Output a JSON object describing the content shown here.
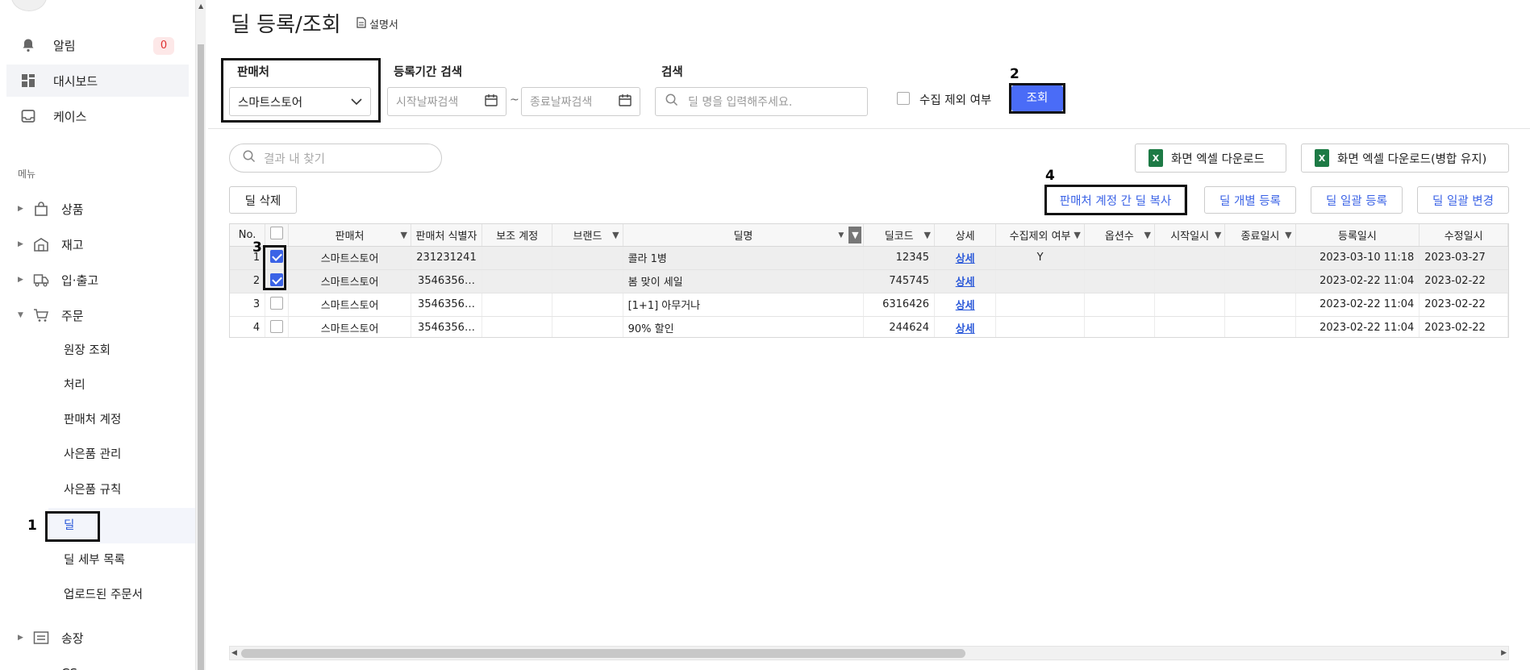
{
  "sidebar": {
    "alerts_label": "알림",
    "alerts_count": "0",
    "dashboard_label": "대시보드",
    "cases_label": "케이스",
    "menu_heading": "메뉴",
    "menu": [
      {
        "label": "상품",
        "icon": "bag-icon"
      },
      {
        "label": "재고",
        "icon": "warehouse-icon"
      },
      {
        "label": "입·출고",
        "icon": "truck-icon"
      },
      {
        "label": "주문",
        "icon": "cart-icon"
      }
    ],
    "order_sub": [
      "원장 조회",
      "처리",
      "판매처 계정",
      "사은품 관리",
      "사은품 규칙",
      "딜",
      "딜 세부 목록",
      "업로드된 주문서"
    ],
    "invoice_label": "송장",
    "cs_label": "CS"
  },
  "annotations": {
    "n1": "1",
    "n2": "2",
    "n3": "3",
    "n4": "4"
  },
  "header": {
    "title": "딜 등록/조회",
    "manual": "설명서"
  },
  "filters": {
    "seller_label": "판매처",
    "seller_value": "스마트스토어",
    "period_label": "등록기간 검색",
    "start_placeholder": "시작날짜검색",
    "end_placeholder": "종료날짜검색",
    "tilde": "~",
    "search_label": "검색",
    "search_placeholder": "딜 명을 입력해주세요.",
    "exclude_label": "수집 제외 여부",
    "query_button": "조회"
  },
  "toolbar": {
    "find_placeholder": "결과 내 찾기",
    "excel_download": "화면 엑셀 다운로드",
    "excel_download_merge": "화면 엑셀 다운로드(병합 유지)",
    "delete_deal": "딜 삭제",
    "copy_between_accounts": "판매처 계정 간 딜 복사",
    "register_single": "딜 개별 등록",
    "register_bulk": "딜 일괄 등록",
    "change_bulk": "딜 일괄 변경"
  },
  "table": {
    "columns": [
      "No.",
      "",
      "판매처",
      "판매처 식별자",
      "보조 계정",
      "브랜드",
      "딜명",
      "딜코드",
      "상세",
      "수집제외 여부",
      "옵션수",
      "시작일시",
      "종료일시",
      "등록일시",
      "수정일시"
    ],
    "rows": [
      {
        "no": "1",
        "checked": true,
        "seller": "스마트스토어",
        "seller_id": "231231241",
        "sub_account": "",
        "brand": "",
        "deal_name": "콜라 1병",
        "deal_code": "12345",
        "detail": "상세",
        "excluded": "Y",
        "options": "",
        "start": "",
        "end": "",
        "registered": "2023-03-10 11:18",
        "modified": "2023-03-27"
      },
      {
        "no": "2",
        "checked": true,
        "seller": "스마트스토어",
        "seller_id": "3546356…",
        "sub_account": "",
        "brand": "",
        "deal_name": "봄 맞이 세일",
        "deal_code": "745745",
        "detail": "상세",
        "excluded": "",
        "options": "",
        "start": "",
        "end": "",
        "registered": "2023-02-22 11:04",
        "modified": "2023-02-22"
      },
      {
        "no": "3",
        "checked": false,
        "seller": "스마트스토어",
        "seller_id": "3546356…",
        "sub_account": "",
        "brand": "",
        "deal_name": "[1+1] 아무거나",
        "deal_code": "6316426",
        "detail": "상세",
        "excluded": "",
        "options": "",
        "start": "",
        "end": "",
        "registered": "2023-02-22 11:04",
        "modified": "2023-02-22"
      },
      {
        "no": "4",
        "checked": false,
        "seller": "스마트스토어",
        "seller_id": "3546356…",
        "sub_account": "",
        "brand": "",
        "deal_name": "90% 할인",
        "deal_code": "244624",
        "detail": "상세",
        "excluded": "",
        "options": "",
        "start": "",
        "end": "",
        "registered": "2023-02-22 11:04",
        "modified": "2023-02-22"
      }
    ]
  },
  "colors": {
    "primary": "#4a6cf7",
    "link": "#2b59d9",
    "badge": "#e03131",
    "selected_row": "#eeeeee"
  }
}
